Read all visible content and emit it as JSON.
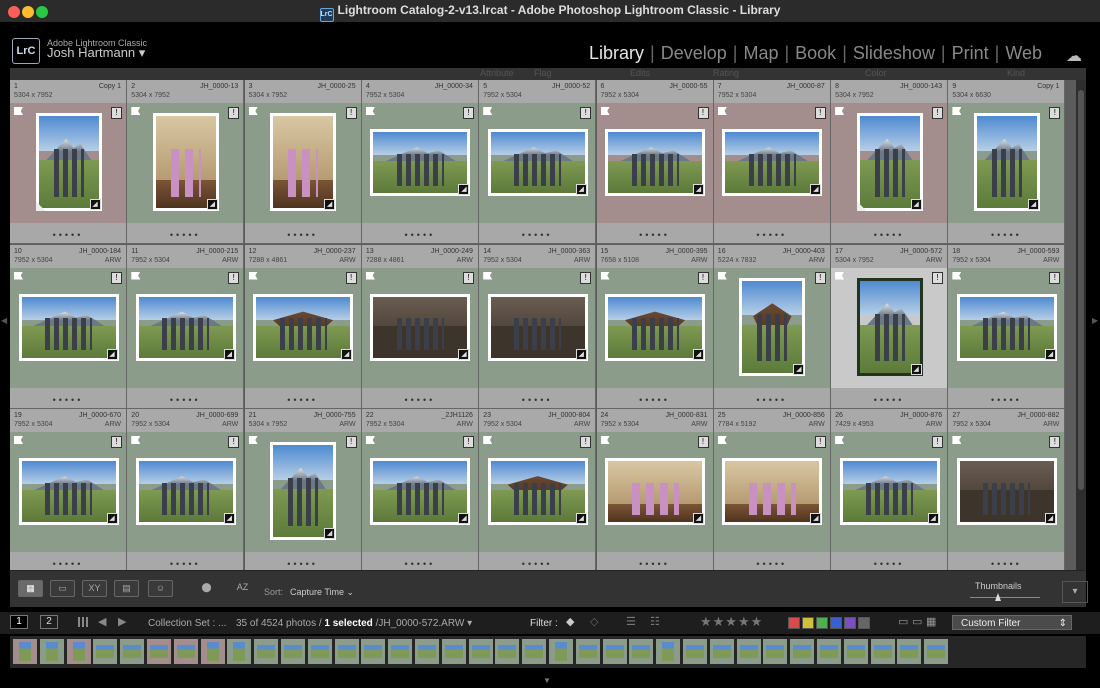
{
  "window": {
    "title": "Lightroom Catalog-2-v13.lrcat - Adobe Photoshop Lightroom Classic - Library"
  },
  "identity": {
    "logo": "LrC",
    "app": "Adobe Lightroom Classic",
    "user": "Josh Hartmann"
  },
  "modules": [
    "Library",
    "Develop",
    "Map",
    "Book",
    "Slideshow",
    "Print",
    "Web"
  ],
  "active_module": "Library",
  "filter_bar": {
    "attribute": "Attribute",
    "flag": "Flag",
    "edits": "Edits",
    "rating": "Rating",
    "color": "Color",
    "kind": "Kind"
  },
  "grid": [
    {
      "num": "1",
      "name": "Copy 1",
      "dims": "5304 x 7952",
      "ext": "",
      "status": "rejected",
      "orient": "portrait",
      "scene": "mountain"
    },
    {
      "num": "2",
      "name": "JH_0000-13",
      "dims": "5304 x 7952",
      "ext": "",
      "status": "picked",
      "orient": "portrait",
      "scene": "indoor"
    },
    {
      "num": "3",
      "name": "JH_0000-25",
      "dims": "5304 x 7952",
      "ext": "",
      "status": "picked",
      "orient": "portrait",
      "scene": "indoor"
    },
    {
      "num": "4",
      "name": "JH_0000-34",
      "dims": "7952 x 5304",
      "ext": "",
      "status": "picked",
      "orient": "landscape",
      "scene": "mountain"
    },
    {
      "num": "5",
      "name": "JH_0000-52",
      "dims": "7952 x 5304",
      "ext": "",
      "status": "picked",
      "orient": "landscape",
      "scene": "mountain"
    },
    {
      "num": "6",
      "name": "JH_0000-55",
      "dims": "7952 x 5304",
      "ext": "",
      "status": "rejected",
      "orient": "landscape",
      "scene": "mountain"
    },
    {
      "num": "7",
      "name": "JH_0000-87",
      "dims": "7952 x 5304",
      "ext": "",
      "status": "rejected",
      "orient": "landscape",
      "scene": "mountain"
    },
    {
      "num": "8",
      "name": "JH_0000-143",
      "dims": "5304 x 7952",
      "ext": "",
      "status": "rejected",
      "orient": "portrait",
      "scene": "mountain"
    },
    {
      "num": "9",
      "name": "Copy 1",
      "dims": "5304 x 6630",
      "ext": "",
      "status": "picked",
      "orient": "portrait",
      "scene": "mountain"
    },
    {
      "num": "10",
      "name": "JH_0000-184",
      "dims": "7952 x 5304",
      "ext": "ARW",
      "status": "picked",
      "orient": "landscape",
      "scene": "mountain"
    },
    {
      "num": "11",
      "name": "JH_0000-215",
      "dims": "7952 x 5304",
      "ext": "ARW",
      "status": "picked",
      "orient": "landscape",
      "scene": "mountain"
    },
    {
      "num": "12",
      "name": "JH_0000-237",
      "dims": "7288 x 4861",
      "ext": "ARW",
      "status": "picked",
      "orient": "landscape",
      "scene": "gazebo"
    },
    {
      "num": "13",
      "name": "JH_0000-249",
      "dims": "7288 x 4861",
      "ext": "ARW",
      "status": "picked",
      "orient": "landscape",
      "scene": "dark"
    },
    {
      "num": "14",
      "name": "JH_0000-363",
      "dims": "7952 x 5304",
      "ext": "ARW",
      "status": "picked",
      "orient": "landscape",
      "scene": "dark"
    },
    {
      "num": "15",
      "name": "JH_0000-395",
      "dims": "7658 x 5108",
      "ext": "ARW",
      "status": "picked",
      "orient": "landscape",
      "scene": "gazebo"
    },
    {
      "num": "16",
      "name": "JH_0000-403",
      "dims": "5224 x 7832",
      "ext": "ARW",
      "status": "picked",
      "orient": "portrait",
      "scene": "gazebo"
    },
    {
      "num": "17",
      "name": "JH_0000-572",
      "dims": "5304 x 7952",
      "ext": "ARW",
      "status": "selected",
      "orient": "portrait",
      "scene": "mountain"
    },
    {
      "num": "18",
      "name": "JH_0000-593",
      "dims": "7952 x 5304",
      "ext": "ARW",
      "status": "picked",
      "orient": "landscape",
      "scene": "mountain"
    },
    {
      "num": "19",
      "name": "JH_0000-670",
      "dims": "7952 x 5304",
      "ext": "ARW",
      "status": "picked",
      "orient": "landscape",
      "scene": "mountain"
    },
    {
      "num": "20",
      "name": "JH_0000-699",
      "dims": "7952 x 5304",
      "ext": "ARW",
      "status": "picked",
      "orient": "landscape",
      "scene": "mountain"
    },
    {
      "num": "21",
      "name": "JH_0000-755",
      "dims": "5304 x 7952",
      "ext": "ARW",
      "status": "picked",
      "orient": "portrait",
      "scene": "mountain"
    },
    {
      "num": "22",
      "name": "_2JH1126",
      "dims": "7952 x 5304",
      "ext": "ARW",
      "status": "picked",
      "orient": "landscape",
      "scene": "mountain"
    },
    {
      "num": "23",
      "name": "JH_0000-804",
      "dims": "7952 x 5304",
      "ext": "ARW",
      "status": "picked",
      "orient": "landscape",
      "scene": "gazebo"
    },
    {
      "num": "24",
      "name": "JH_0000-831",
      "dims": "7952 x 5304",
      "ext": "ARW",
      "status": "picked",
      "orient": "landscape",
      "scene": "indoor"
    },
    {
      "num": "25",
      "name": "JH_0000-856",
      "dims": "7784 x 5192",
      "ext": "ARW",
      "status": "picked",
      "orient": "landscape",
      "scene": "indoor"
    },
    {
      "num": "26",
      "name": "JH_0000-876",
      "dims": "7429 x 4953",
      "ext": "ARW",
      "status": "picked",
      "orient": "landscape",
      "scene": "mountain"
    },
    {
      "num": "27",
      "name": "JH_0000-882",
      "dims": "7952 x 5304",
      "ext": "ARW",
      "status": "picked",
      "orient": "landscape",
      "scene": "dark"
    }
  ],
  "toolbar": {
    "sort_label": "Sort:",
    "sort_value": "Capture Time",
    "thumbnails_label": "Thumbnails"
  },
  "filmstrip_bar": {
    "page1": "1",
    "page2": "2",
    "source": "Collection Set : ...",
    "count_pre": "35 of 4524 photos /",
    "count_sel": "1 selected",
    "count_file": "/JH_0000-572.ARW",
    "filter_label": "Filter :",
    "stars": "★★★★★",
    "custom_filter": "Custom Filter",
    "color_labels": [
      "#d94a4a",
      "#cfc13a",
      "#4fb04f",
      "#3a5fcf",
      "#7a4fbf",
      "#666666"
    ]
  },
  "filmstrip": [
    "rejected",
    "picked",
    "rejected",
    "picked",
    "picked",
    "rejected",
    "rejected",
    "rejected",
    "picked",
    "picked",
    "picked",
    "picked",
    "picked",
    "picked",
    "picked",
    "picked",
    "picked",
    "picked",
    "picked",
    "picked",
    "picked",
    "picked",
    "picked",
    "picked",
    "picked",
    "picked",
    "picked",
    "picked",
    "picked",
    "picked",
    "picked",
    "picked",
    "picked",
    "picked",
    "picked"
  ]
}
